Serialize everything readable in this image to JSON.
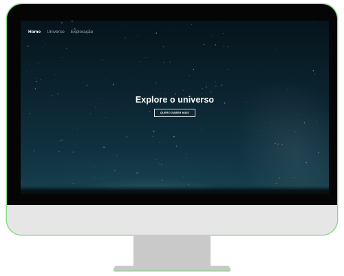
{
  "nav": {
    "items": [
      {
        "label": "Home",
        "active": true
      },
      {
        "label": "Universo",
        "active": false
      },
      {
        "label": "Exploração",
        "active": false
      }
    ]
  },
  "hero": {
    "title": "Explore o universo",
    "cta_label": "QUERO SABER MAIS"
  },
  "colors": {
    "sky_top": "#06141c",
    "sky_bottom": "#16404d",
    "monitor_bezel": "#050505",
    "monitor_chin": "#e6e6e6",
    "stand": "#c9c9c9",
    "outline_accent": "#8fd68f"
  }
}
